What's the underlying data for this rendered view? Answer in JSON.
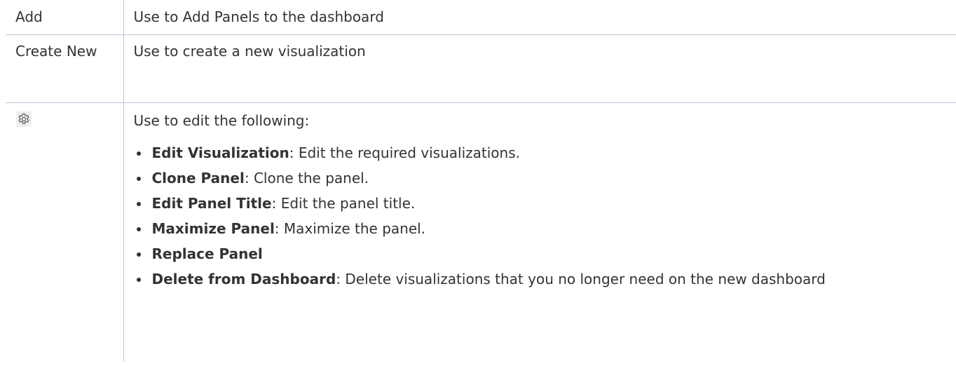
{
  "rows": {
    "add": {
      "key": "Add",
      "description": "Use to Add Panels to the dashboard"
    },
    "create_new": {
      "key": "Create New",
      "description": "Use to create a new visualization"
    },
    "settings": {
      "key_icon": "gear-icon",
      "intro": "Use to edit the following:",
      "items": [
        {
          "term": "Edit Visualization",
          "sep": ": ",
          "text": "Edit the required visualizations."
        },
        {
          "term": "Clone Panel",
          "sep": ": ",
          "text": "Clone the panel."
        },
        {
          "term": "Edit Panel Title",
          "sep": ": ",
          "text": "Edit the panel title."
        },
        {
          "term": "Maximize Panel",
          "sep": ": ",
          "text": "Maximize the panel."
        },
        {
          "term": "Replace Panel",
          "sep": "",
          "text": ""
        },
        {
          "term": "Delete from Dashboard",
          "sep": ": ",
          "text": "Delete visualizations that you no longer need on the new dashboard"
        }
      ]
    }
  },
  "colors": {
    "text": "#333333",
    "border": "#b8c6d6",
    "icon_bg": "#eeeeee"
  }
}
